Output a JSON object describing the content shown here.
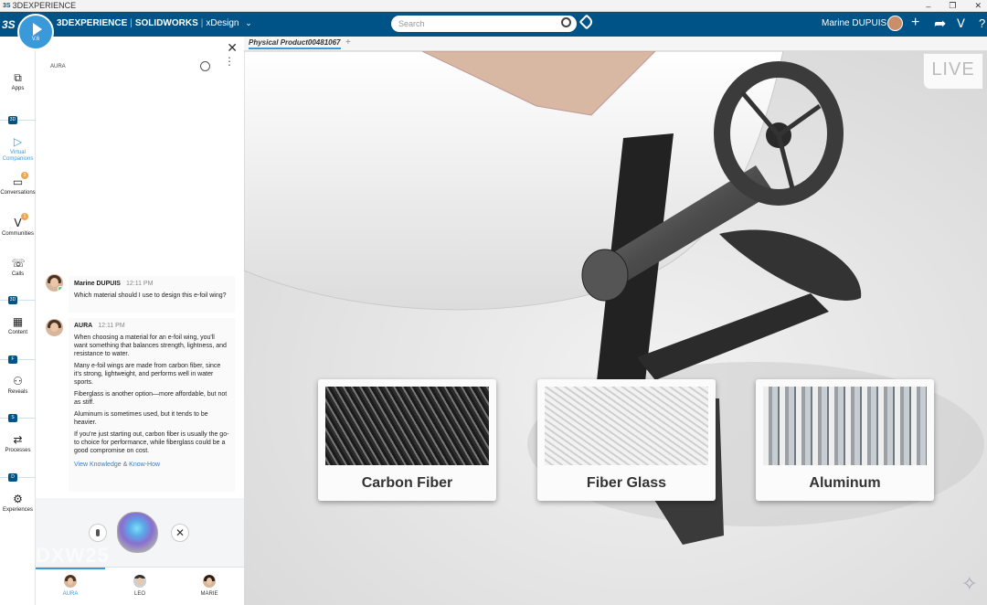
{
  "window": {
    "title": "3DEXPERIENCE",
    "controls": [
      "–",
      "❐",
      "✕"
    ]
  },
  "topbar": {
    "logo": "3S",
    "compass_version": "V.6",
    "brand_main": "3DEXPERIENCE",
    "brand_app": "SOLIDWORKS",
    "brand_role": "xDesign",
    "search_placeholder": "Search",
    "user_first": "Marine",
    "user_last": "DUPUIS",
    "colors": {
      "bar": "#005386",
      "accent": "#3a9ad9"
    }
  },
  "sidebar": {
    "items": [
      {
        "label": "Apps",
        "icon": "apps-icon"
      },
      {
        "label": "Virtual Companions",
        "icon": "companion-icon",
        "selected": true
      },
      {
        "label": "Conversations",
        "icon": "conversation-icon",
        "badge": "3"
      },
      {
        "label": "Communities",
        "icon": "communities-icon",
        "badge": "1"
      },
      {
        "label": "Calls",
        "icon": "phone-icon"
      },
      {
        "label": "Content",
        "icon": "grid-icon"
      },
      {
        "label": "Reveals",
        "icon": "binoculars-icon"
      },
      {
        "label": "Processes",
        "icon": "process-icon"
      },
      {
        "label": "Experiences",
        "icon": "experience-icon"
      }
    ],
    "markers": [
      "3D",
      "3D",
      "3D",
      "F",
      "S",
      "D"
    ]
  },
  "panel": {
    "title": "AURA",
    "messages": [
      {
        "author": "Marine DUPUIS",
        "time": "12:11 PM",
        "text": "Which material should I use to design this e-foil wing?"
      },
      {
        "author": "AURA",
        "time": "12:11 PM",
        "paragraphs": [
          "When choosing a material for an e-foil wing, you'll want something that balances strength, lightness, and resistance to water.",
          "Many e-foil wings are made from carbon fiber, since it's strong, lightweight, and performs well in water sports.",
          "Fiberglass is another option—more affordable, but not as stiff.",
          "Aluminum is sometimes used, but it tends to be heavier.",
          "If you're just starting out, carbon fiber is usually the go-to choice for performance, while fiberglass could be a good compromise on cost."
        ],
        "link": "View Knowledge & Know-How"
      }
    ],
    "watermark": "DXW25",
    "companions": [
      {
        "name": "AURA",
        "selected": true
      },
      {
        "name": "LEO"
      },
      {
        "name": "MARIE"
      }
    ]
  },
  "viewport": {
    "tab": "Physical Product00481067",
    "tab_add": "+",
    "live": "LIVE",
    "materials": [
      {
        "label": "Carbon Fiber",
        "icon": "carbon-fiber-image"
      },
      {
        "label": "Fiber Glass",
        "icon": "fiber-glass-image"
      },
      {
        "label": "Aluminum",
        "icon": "aluminum-image"
      }
    ]
  }
}
